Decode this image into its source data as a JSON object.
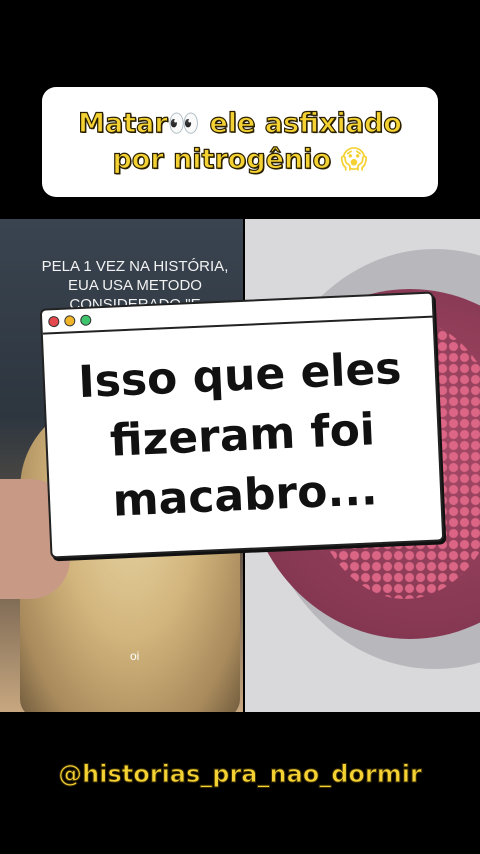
{
  "title": {
    "line1_before": "Matar",
    "line1_emoji": "👀",
    "line1_after": "ele asfixiado",
    "line2_text": "por nitrogênio",
    "line2_emoji": "😱"
  },
  "left_video": {
    "overlay_lines": [
      "PELA 1 VEZ NA HISTÓRIA,",
      "EUA USA METODO",
      "CONSIDERADO \"E"
    ],
    "caption": "oi"
  },
  "dialog": {
    "lines": [
      "Isso que eles",
      "fizeram foi",
      "macabro..."
    ],
    "dot_colors": [
      "#e5484d",
      "#f0b429",
      "#3ec46d"
    ]
  },
  "handle": "@historias_pra_nao_dormir",
  "colors": {
    "title_yellow": "#f5d233",
    "background": "#000000"
  }
}
